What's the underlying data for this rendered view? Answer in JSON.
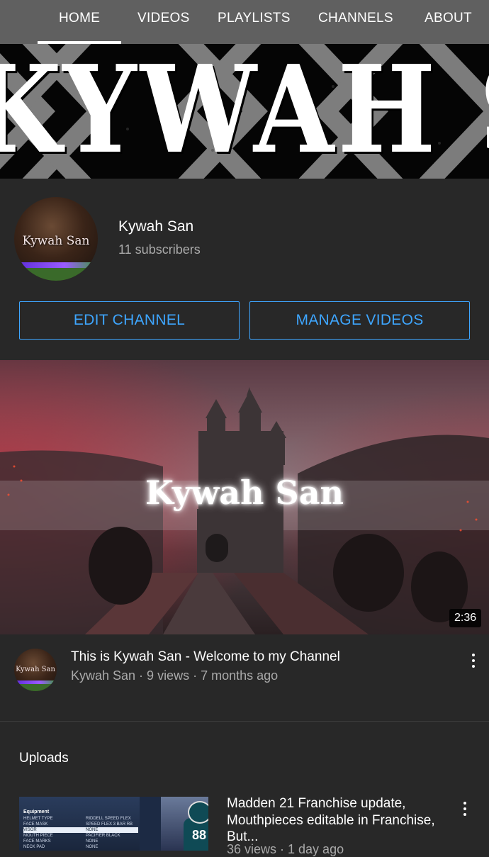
{
  "tabs": [
    {
      "label": "HOME",
      "active": true
    },
    {
      "label": "VIDEOS",
      "active": false
    },
    {
      "label": "PLAYLISTS",
      "active": false
    },
    {
      "label": "CHANNELS",
      "active": false
    },
    {
      "label": "ABOUT",
      "active": false
    }
  ],
  "banner": {
    "text": "KYWAH SAN"
  },
  "channel": {
    "avatar_text": "Kywah San",
    "name": "Kywah San",
    "subscribers": "11 subscribers"
  },
  "buttons": {
    "edit_channel": "EDIT CHANNEL",
    "manage_videos": "MANAGE VIDEOS"
  },
  "featured": {
    "overlay_title": "Kywah San",
    "duration": "2:36",
    "title": "This is Kywah San - Welcome to my Channel",
    "meta": "Kywah San · 9 views · 7 months ago",
    "avatar_text": "Kywah San"
  },
  "uploads": {
    "section_title": "Uploads",
    "items": [
      {
        "title": "Madden 21 Franchise update, Mouthpieces editable in Franchise, But...",
        "meta": "36 views · 1 day ago",
        "thumb": {
          "heading": "Equipment",
          "rows": [
            [
              "HELMET TYPE",
              "RIDDELL SPEED FLEX"
            ],
            [
              "FACE MASK",
              "SPEED FLEX 3 BAR RB"
            ],
            [
              "VISOR",
              "NONE"
            ],
            [
              "MOUTH PIECE",
              "PACIFIER BLACK"
            ],
            [
              "FACE MARKS",
              "NONE"
            ],
            [
              "NECK PAD",
              "NONE"
            ]
          ],
          "jersey_number": "88"
        }
      }
    ]
  },
  "colors": {
    "accent_blue": "#3ea6ff",
    "background": "#282828",
    "tabbar": "#606060",
    "secondary_text": "#aaaaaa"
  },
  "icons": {
    "more": "more-vert-icon"
  }
}
